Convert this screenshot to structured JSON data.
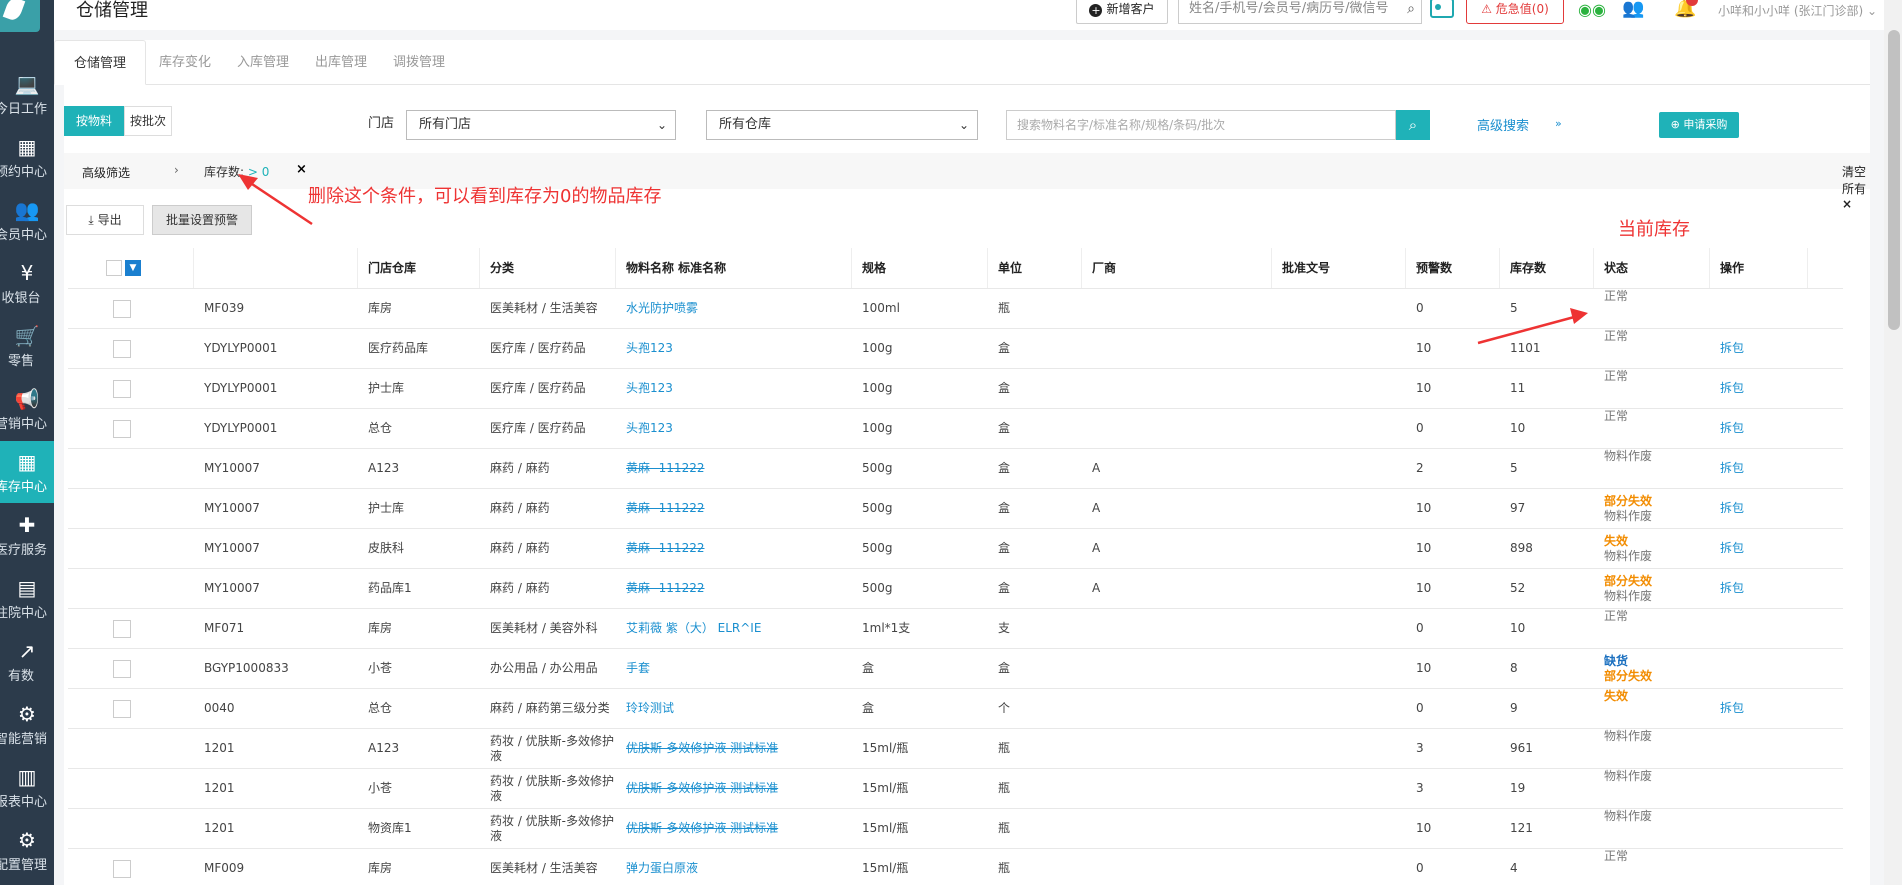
{
  "sidebar": {
    "items": [
      {
        "label": "今日工作",
        "icon": "laptop-icon"
      },
      {
        "label": "预约中心",
        "icon": "calendar-icon"
      },
      {
        "label": "会员中心",
        "icon": "users-icon"
      },
      {
        "label": "收银台",
        "icon": "yen-icon"
      },
      {
        "label": "零售",
        "icon": "cart-icon"
      },
      {
        "label": "营销中心",
        "icon": "megaphone-icon"
      },
      {
        "label": "库存中心",
        "icon": "grid-icon"
      },
      {
        "label": "医疗服务",
        "icon": "medkit-icon"
      },
      {
        "label": "住院中心",
        "icon": "building-icon"
      },
      {
        "label": "有数",
        "icon": "line-chart-icon"
      },
      {
        "label": "智能营销",
        "icon": "robot-icon"
      },
      {
        "label": "报表中心",
        "icon": "bar-chart-icon"
      },
      {
        "label": "配置管理",
        "icon": "gear-icon"
      }
    ],
    "active_index": 6
  },
  "header": {
    "title": "仓储管理",
    "new_customer": "新增客户",
    "search_placeholder": "姓名/手机号/会员号/病历号/微信号",
    "urgent": "危急值(0)",
    "user": "小咩和小小咩 (张江门诊部)"
  },
  "tabs": [
    "仓储管理",
    "库存变化",
    "入库管理",
    "出库管理",
    "调拨管理"
  ],
  "toolbar": {
    "by_item": "按物料",
    "by_batch": "按批次",
    "store_label": "门店",
    "store_select": "所有门店",
    "warehouse_select": "所有仓库",
    "search_placeholder": "搜索物料名字/标准名称/规格/条码/批次",
    "advanced_search": "高级搜索",
    "apply_purchase": "申请采购"
  },
  "filter": {
    "label": "高级筛选",
    "condition_name": "库存数:",
    "condition_value": "> 0",
    "clear_all": "清空所有"
  },
  "actions": {
    "export": "导出",
    "batch_alert": "批量设置预警"
  },
  "annotations": {
    "remove_condition": "删除这个条件，可以看到库存为0的物品库存",
    "current_stock": "当前库存"
  },
  "table": {
    "headers": [
      "门店仓库",
      "分类",
      "物料名称 标准名称",
      "规格",
      "单位",
      "厂商",
      "批准文号",
      "预警数",
      "库存数",
      "状态",
      "操作"
    ],
    "rows": [
      {
        "checkbox": true,
        "code": "MF039",
        "store": "库房",
        "category": "医美耗材 / 生活美容",
        "name": "水光防护喷雾",
        "style": "link",
        "spec": "100ml",
        "unit": "瓶",
        "vendor": "",
        "approval": "",
        "alert": "0",
        "stock": "5",
        "status": [
          [
            "正常",
            "gray"
          ]
        ],
        "op": ""
      },
      {
        "checkbox": true,
        "code": "YDYLYP0001",
        "store": "医疗药品库",
        "category": "医疗库 / 医疗药品",
        "name": "头孢123",
        "style": "link",
        "spec": "100g",
        "unit": "盒",
        "vendor": "",
        "approval": "",
        "alert": "10",
        "stock": "1101",
        "status": [
          [
            "正常",
            "gray"
          ]
        ],
        "op": "拆包"
      },
      {
        "checkbox": true,
        "code": "YDYLYP0001",
        "store": "护士库",
        "category": "医疗库 / 医疗药品",
        "name": "头孢123",
        "style": "link",
        "spec": "100g",
        "unit": "盒",
        "vendor": "",
        "approval": "",
        "alert": "10",
        "stock": "11",
        "status": [
          [
            "正常",
            "gray"
          ]
        ],
        "op": "拆包"
      },
      {
        "checkbox": true,
        "code": "YDYLYP0001",
        "store": "总仓",
        "category": "医疗库 / 医疗药品",
        "name": "头孢123",
        "style": "link",
        "spec": "100g",
        "unit": "盒",
        "vendor": "",
        "approval": "",
        "alert": "0",
        "stock": "10",
        "status": [
          [
            "正常",
            "gray"
          ]
        ],
        "op": "拆包"
      },
      {
        "checkbox": false,
        "code": "MY10007",
        "store": "A123",
        "category": "麻药 / 麻药",
        "name": "黄麻--111222",
        "style": "strike",
        "spec": "500g",
        "unit": "盒",
        "vendor": "A",
        "approval": "",
        "alert": "2",
        "stock": "5",
        "status": [
          [
            "物料作废",
            "gray"
          ]
        ],
        "op": "拆包"
      },
      {
        "checkbox": false,
        "code": "MY10007",
        "store": "护士库",
        "category": "麻药 / 麻药",
        "name": "黄麻--111222",
        "style": "strike",
        "spec": "500g",
        "unit": "盒",
        "vendor": "A",
        "approval": "",
        "alert": "10",
        "stock": "97",
        "status": [
          [
            "部分失效",
            "orange"
          ],
          [
            "物料作废",
            "gray"
          ]
        ],
        "op": "拆包"
      },
      {
        "checkbox": false,
        "code": "MY10007",
        "store": "皮肤科",
        "category": "麻药 / 麻药",
        "name": "黄麻--111222",
        "style": "strike",
        "spec": "500g",
        "unit": "盒",
        "vendor": "A",
        "approval": "",
        "alert": "10",
        "stock": "898",
        "status": [
          [
            "失效",
            "orange"
          ],
          [
            "物料作废",
            "gray"
          ]
        ],
        "op": "拆包"
      },
      {
        "checkbox": false,
        "code": "MY10007",
        "store": "药品库1",
        "category": "麻药 / 麻药",
        "name": "黄麻--111222",
        "style": "strike",
        "spec": "500g",
        "unit": "盒",
        "vendor": "A",
        "approval": "",
        "alert": "10",
        "stock": "52",
        "status": [
          [
            "部分失效",
            "orange"
          ],
          [
            "物料作废",
            "gray"
          ]
        ],
        "op": "拆包"
      },
      {
        "checkbox": true,
        "code": "MF071",
        "store": "库房",
        "category": "医美耗材 / 美容外科",
        "name": "艾莉薇 紫（大） ELR^IE",
        "style": "link",
        "spec": "1ml*1支",
        "unit": "支",
        "vendor": "",
        "approval": "",
        "alert": "0",
        "stock": "10",
        "status": [
          [
            "正常",
            "gray"
          ]
        ],
        "op": ""
      },
      {
        "checkbox": true,
        "code": "BGYP1000833",
        "store": "小苍",
        "category": "办公用品 / 办公用品",
        "name": "手套",
        "style": "link",
        "spec": "盒",
        "unit": "盒",
        "vendor": "",
        "approval": "",
        "alert": "10",
        "stock": "8",
        "status": [
          [
            "缺货",
            "blue"
          ],
          [
            "部分失效",
            "orange"
          ]
        ],
        "op": ""
      },
      {
        "checkbox": true,
        "code": "0040",
        "store": "总仓",
        "category": "麻药 / 麻药第三级分类",
        "name": "玲玲测试",
        "style": "link",
        "spec": "盒",
        "unit": "个",
        "vendor": "",
        "approval": "",
        "alert": "0",
        "stock": "9",
        "status": [
          [
            "失效",
            "orange"
          ]
        ],
        "op": "拆包"
      },
      {
        "checkbox": false,
        "code": "1201",
        "store": "A123",
        "category": "药妆 / 优肤斯-多效修护液",
        "name": "优肤斯-多效修护液 测试标准",
        "style": "strike",
        "spec": "15ml/瓶",
        "unit": "瓶",
        "vendor": "",
        "approval": "",
        "alert": "3",
        "stock": "961",
        "status": [
          [
            "物料作废",
            "gray"
          ]
        ],
        "op": ""
      },
      {
        "checkbox": false,
        "code": "1201",
        "store": "小苍",
        "category": "药妆 / 优肤斯-多效修护液",
        "name": "优肤斯-多效修护液 测试标准",
        "style": "strike",
        "spec": "15ml/瓶",
        "unit": "瓶",
        "vendor": "",
        "approval": "",
        "alert": "3",
        "stock": "19",
        "status": [
          [
            "物料作废",
            "gray"
          ]
        ],
        "op": ""
      },
      {
        "checkbox": false,
        "code": "1201",
        "store": "物资库1",
        "category": "药妆 / 优肤斯-多效修护液",
        "name": "优肤斯-多效修护液 测试标准",
        "style": "strike",
        "spec": "15ml/瓶",
        "unit": "瓶",
        "vendor": "",
        "approval": "",
        "alert": "10",
        "stock": "121",
        "status": [
          [
            "物料作废",
            "gray"
          ]
        ],
        "op": ""
      },
      {
        "checkbox": true,
        "code": "MF009",
        "store": "库房",
        "category": "医美耗材 / 生活美容",
        "name": "弹力蛋白原液",
        "style": "link",
        "spec": "15ml/瓶",
        "unit": "瓶",
        "vendor": "",
        "approval": "",
        "alert": "0",
        "stock": "4",
        "status": [
          [
            "正常",
            "gray"
          ]
        ],
        "op": ""
      }
    ]
  },
  "colors": {
    "sidebar_bg": "#2c3b4b",
    "accent": "#1fb2b8",
    "link": "#1a8fcf",
    "annotation": "#e33333"
  }
}
